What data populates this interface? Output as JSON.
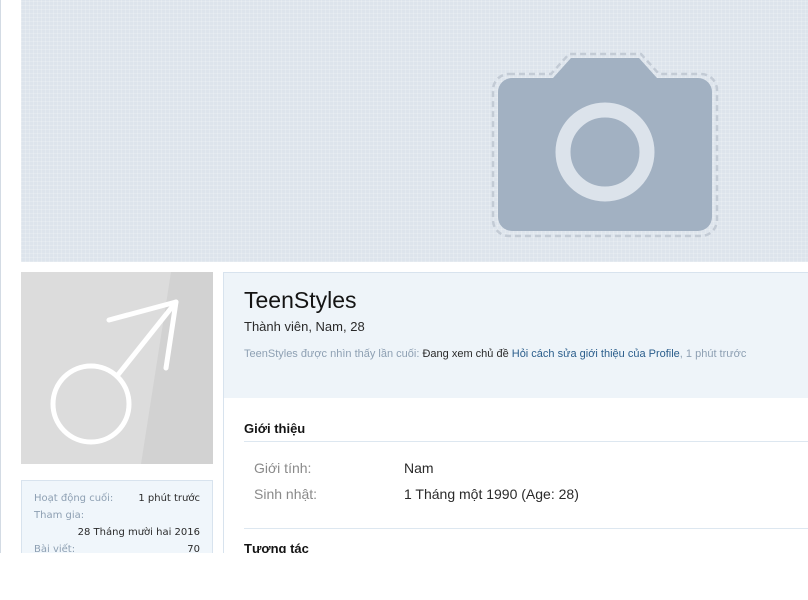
{
  "cover": {
    "icon": "camera-icon"
  },
  "avatar": {
    "icon": "male-symbol-icon"
  },
  "stats": {
    "last_activity_label": "Hoạt động cuối:",
    "last_activity_value": "1 phút trước",
    "joined_label": "Tham gia:",
    "joined_value": "28 Tháng mười hai 2016",
    "posts_label": "Bài viết:",
    "posts_value": "70"
  },
  "profile": {
    "username": "TeenStyles",
    "user_title": "Thành viên, Nam, 28",
    "last_seen_prefix": "TeenStyles được nhìn thấy lần cuối:",
    "last_seen_action": "Đang xem chủ đề",
    "last_seen_link": "Hỏi cách sửa giới thiệu của Profile",
    "last_seen_separator": ",",
    "last_seen_time": "1 phút trước"
  },
  "about": {
    "title": "Giới thiệu",
    "gender_label": "Giới tính:",
    "gender_value": "Nam",
    "birthday_label": "Sinh nhật:",
    "birthday_value": "1 Tháng một 1990 (Age: 28)"
  },
  "interact": {
    "title": "Tương tác"
  },
  "colors": {
    "link": "#2b5e8c",
    "muted": "#8ea0b3",
    "cover_bg": "#dde4ec",
    "panel_bg": "#eef4f9"
  }
}
